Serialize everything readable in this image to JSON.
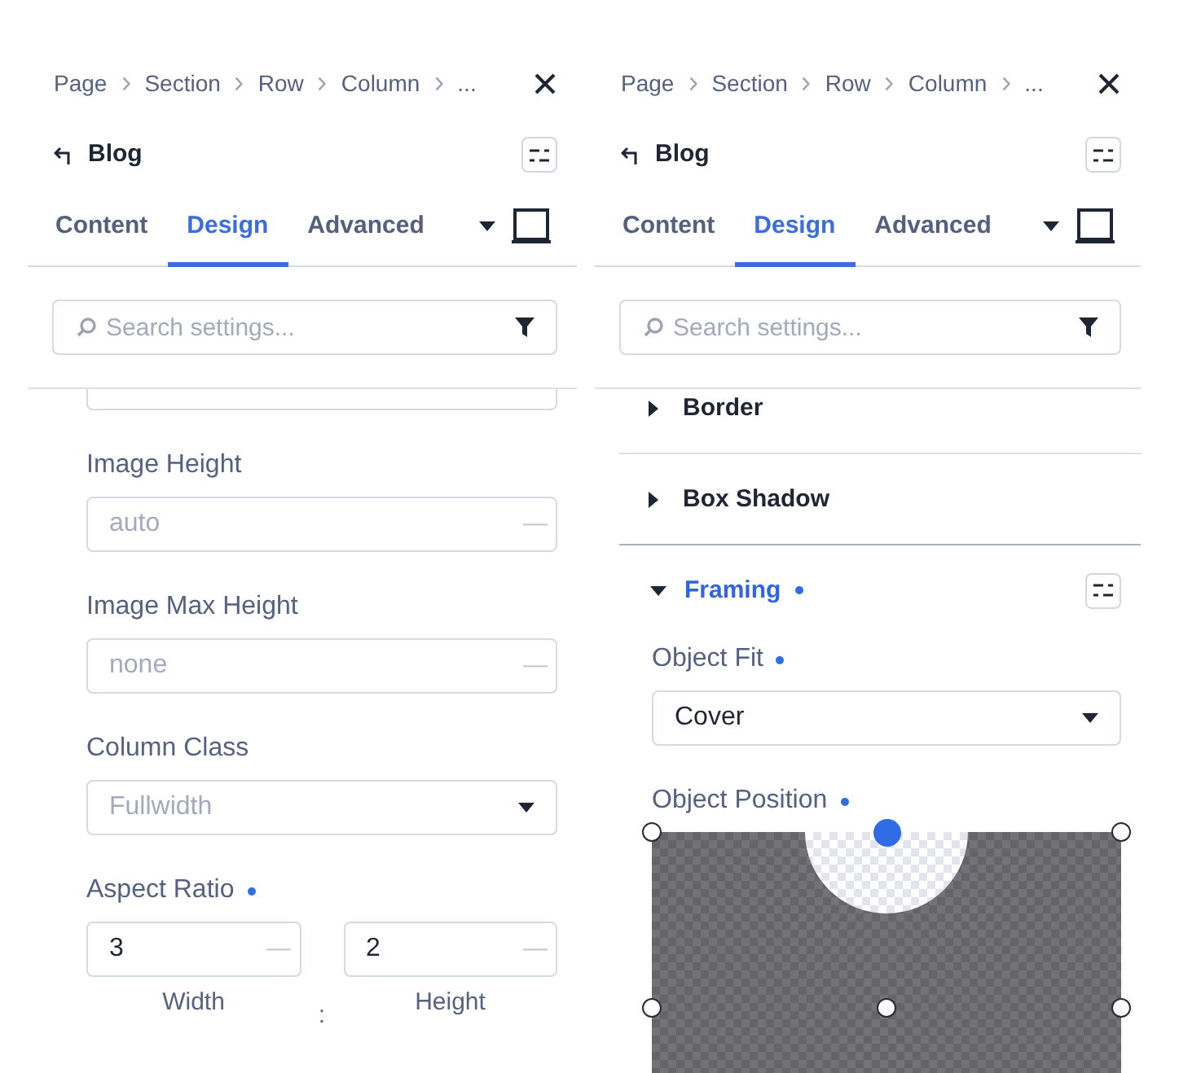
{
  "panels": [
    {
      "breadcrumb": [
        "Page",
        "Section",
        "Row",
        "Column",
        "..."
      ],
      "title": "Blog",
      "tabs": [
        {
          "label": "Content",
          "selected": false
        },
        {
          "label": "Design",
          "selected": true
        },
        {
          "label": "Advanced",
          "selected": false
        }
      ],
      "search": {
        "placeholder": "Search settings..."
      },
      "body": [
        {
          "kind": "clipped"
        },
        {
          "kind": "input",
          "label": "Image Height",
          "modified": false,
          "placeholder": "auto",
          "unit": "—"
        },
        {
          "kind": "input",
          "label": "Image Max Height",
          "modified": false,
          "placeholder": "none",
          "unit": "—"
        },
        {
          "kind": "select",
          "label": "Column Class",
          "modified": false,
          "placeholder": "Fullwidth"
        },
        {
          "kind": "ratio",
          "label": "Aspect Ratio",
          "modified": true,
          "fields": [
            {
              "value": "3",
              "unit": "—",
              "caption": "Width"
            },
            {
              "value": "2",
              "unit": "—",
              "caption": "Height"
            }
          ],
          "separator": ":"
        }
      ]
    },
    {
      "breadcrumb": [
        "Page",
        "Section",
        "Row",
        "Column",
        "..."
      ],
      "title": "Blog",
      "tabs": [
        {
          "label": "Content",
          "selected": false
        },
        {
          "label": "Design",
          "selected": true
        },
        {
          "label": "Advanced",
          "selected": false
        }
      ],
      "search": {
        "placeholder": "Search settings..."
      },
      "body": [
        {
          "kind": "section",
          "title": "Border",
          "expanded": false,
          "modified": false
        },
        {
          "kind": "section",
          "title": "Box Shadow",
          "expanded": false,
          "modified": false
        },
        {
          "kind": "section",
          "title": "Framing",
          "expanded": true,
          "modified": true,
          "children": [
            {
              "kind": "select",
              "label": "Object Fit",
              "modified": true,
              "value": "Cover"
            },
            {
              "kind": "position",
              "label": "Object Position",
              "modified": true,
              "anchors": [
                {
                  "selected": false
                },
                {
                  "selected": true
                },
                {
                  "selected": false
                },
                {
                  "selected": false
                },
                {
                  "selected": false
                },
                {
                  "selected": false
                }
              ]
            }
          ]
        }
      ]
    }
  ]
}
